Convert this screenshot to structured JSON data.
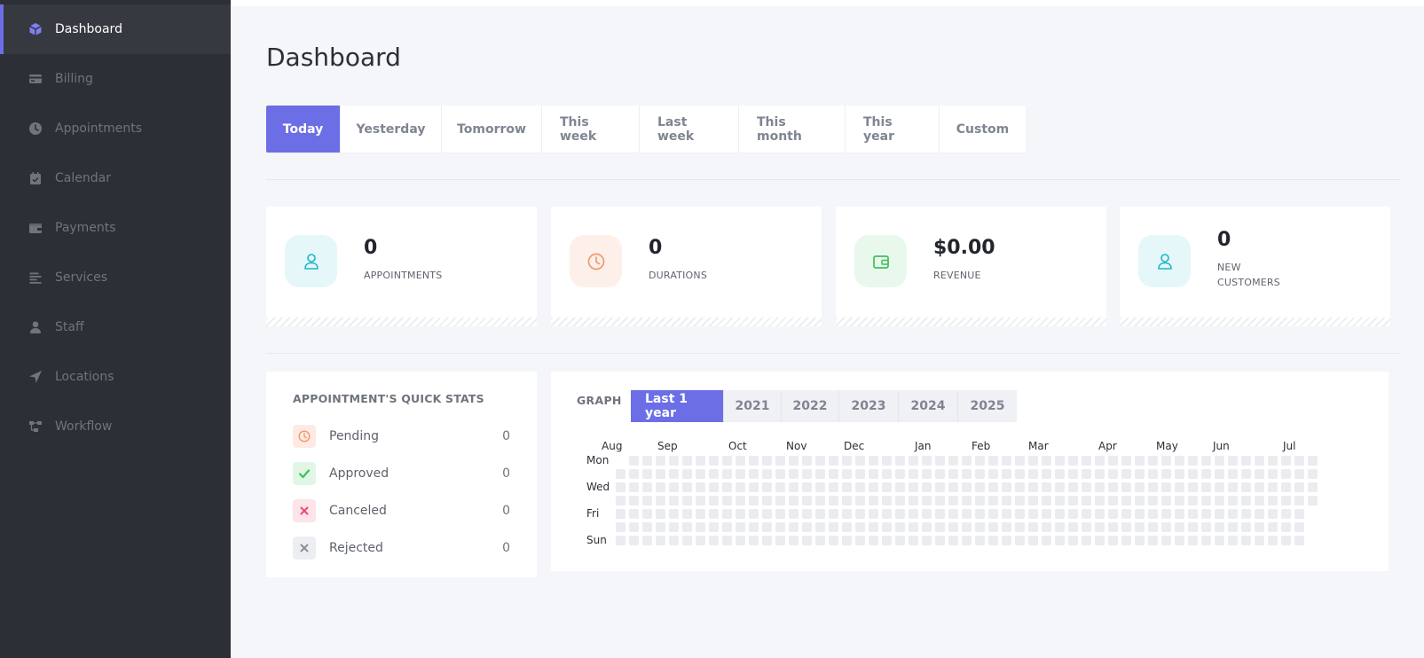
{
  "sidebar": {
    "items": [
      {
        "label": "Dashboard",
        "icon": "cube-icon",
        "active": true
      },
      {
        "label": "Billing",
        "icon": "credit-card-icon",
        "active": false
      },
      {
        "label": "Appointments",
        "icon": "clock-icon",
        "active": false
      },
      {
        "label": "Calendar",
        "icon": "calendar-check-icon",
        "active": false
      },
      {
        "label": "Payments",
        "icon": "wallet-icon",
        "active": false
      },
      {
        "label": "Services",
        "icon": "list-icon",
        "active": false
      },
      {
        "label": "Staff",
        "icon": "user-icon",
        "active": false
      },
      {
        "label": "Locations",
        "icon": "location-arrow-icon",
        "active": false
      },
      {
        "label": "Workflow",
        "icon": "sitemap-icon",
        "active": false
      }
    ]
  },
  "header": {
    "title": "Dashboard"
  },
  "filters": {
    "active": "Today",
    "tabs": [
      "Today",
      "Yesterday",
      "Tomorrow",
      "This week",
      "Last week",
      "This month",
      "This year",
      "Custom"
    ]
  },
  "stats": [
    {
      "value": "0",
      "label": "APPOINTMENTS",
      "icon": "user-icon",
      "color": "#1cb5c9",
      "bg": "#e6f7fa"
    },
    {
      "value": "0",
      "label": "DURATIONS",
      "icon": "clock-icon",
      "color": "#f09a6a",
      "bg": "#fdf0ea"
    },
    {
      "value": "$0.00",
      "label": "REVENUE",
      "icon": "wallet-icon",
      "color": "#3fbf5a",
      "bg": "#e9f8ec"
    },
    {
      "value": "0",
      "label": "NEW\nCUSTOMERS",
      "icon": "user-icon",
      "color": "#1cb5c9",
      "bg": "#e6f7fa"
    }
  ],
  "quick_stats": {
    "title": "APPOINTMENT'S QUICK STATS",
    "rows": [
      {
        "label": "Pending",
        "count": "0",
        "icon": "clock-icon",
        "color": "#f09a6a",
        "bg": "#fdebe3"
      },
      {
        "label": "Approved",
        "count": "0",
        "icon": "check-icon",
        "color": "#3fbf5a",
        "bg": "#e2f6e6"
      },
      {
        "label": "Canceled",
        "count": "0",
        "icon": "x-icon",
        "color": "#e94b6e",
        "bg": "#fde3ea"
      },
      {
        "label": "Rejected",
        "count": "0",
        "icon": "x-icon",
        "color": "#8a909b",
        "bg": "#eceef1"
      }
    ]
  },
  "graph": {
    "label": "GRAPH",
    "active_year": "Last 1 year",
    "year_tabs": [
      "Last 1 year",
      "2021",
      "2022",
      "2023",
      "2024",
      "2025"
    ],
    "months": [
      "Aug",
      "Sep",
      "Oct",
      "Nov",
      "Dec",
      "Jan",
      "Feb",
      "Mar",
      "Apr",
      "May",
      "Jun",
      "Jul"
    ],
    "days": [
      "Mon",
      "Wed",
      "Fri",
      "Sun"
    ]
  },
  "colors": {
    "accent": "#6c6ee6",
    "sidebar_bg": "#2c2f35",
    "cell_empty": "#ebecef"
  }
}
